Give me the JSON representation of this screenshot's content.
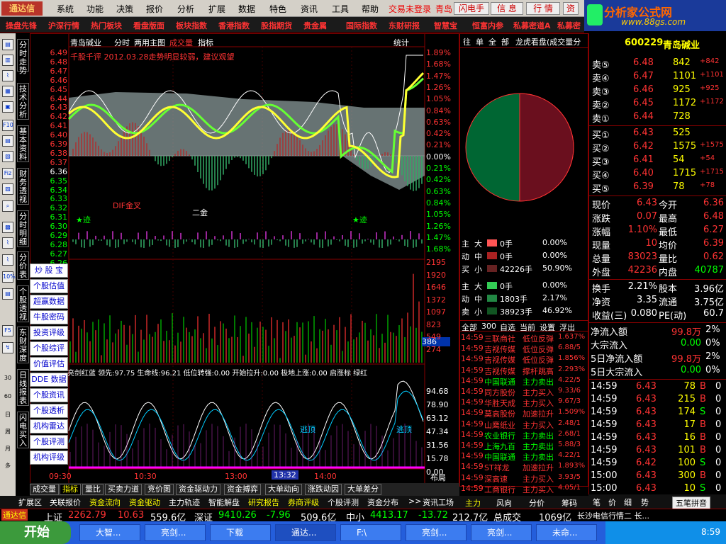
{
  "app": {
    "logo": "通达信",
    "brand_title": "分析家公式网",
    "brand_url": "www.88gs.com"
  },
  "menu": [
    "系统",
    "功能",
    "决策",
    "报价",
    "分析",
    "扩展",
    "数据",
    "特色",
    "资讯",
    "工具",
    "帮助"
  ],
  "menu_extra": {
    "trade": "交易未登录",
    "city": "青岛",
    "flash": "闪电手",
    "info": "信 息",
    "quote": "行 情",
    "more": "资"
  },
  "nav": [
    "操盘先锋",
    "沪深行情",
    "热门板块",
    "看盘版面",
    "板块指数",
    "香港指数",
    "股指期货",
    "贵金属",
    "国际指数",
    "东财研报",
    "智慧宝",
    "恒富内参",
    "私募密道A",
    "私募密"
  ],
  "left_tabs": [
    "分时走势",
    "技术分析",
    "基本资料",
    "财务透视",
    "分时明细",
    "分价表",
    "个股透视",
    "东财深度",
    "日线报表",
    "闪电买入"
  ],
  "left_tools": [
    "F10",
    "Fiz",
    "10%",
    "F5",
    "30",
    "60",
    "日",
    "周",
    "月",
    "多"
  ],
  "side_buttons": [
    "炒 股 宝",
    "个股估值",
    "超赢数据",
    "牛股密码",
    "投资评级",
    "个股综评",
    "价值评估",
    "DDE 数据",
    "个股资讯",
    "个股透析",
    "机构雷达",
    "个股评测",
    "机构评级"
  ],
  "chart": {
    "header": {
      "name": "青岛碱业",
      "mode": "分时",
      "dual": "两用主图",
      "vol": "成交量",
      "ind": "指标",
      "stats": "统计"
    },
    "note": "千股千评 2012.03.28走势明显较弱，建议观望",
    "left_axis": [
      "6.49",
      "6.48",
      "6.47",
      "6.46",
      "6.45",
      "6.44",
      "6.43",
      "6.42",
      "6.41",
      "6.40",
      "6.39",
      "6.38",
      "6.37",
      "6.36",
      "6.35",
      "6.34",
      "6.33",
      "6.32",
      "6.31",
      "6.30",
      "6.29",
      "6.28",
      "6.27",
      "6.26",
      "6.25"
    ],
    "right_axis": [
      "1.89%",
      "1.68%",
      "1.47%",
      "1.26%",
      "1.05%",
      "0.84%",
      "0.63%",
      "0.42%",
      "0.21%",
      "0.00%",
      "0.21%",
      "0.42%",
      "0.63%",
      "0.84%",
      "1.05%",
      "1.26%",
      "1.47%",
      "1.68%"
    ],
    "vol_axis": [
      "2195",
      "1920",
      "1646",
      "1372",
      "1097",
      "823",
      "549",
      "274"
    ],
    "vol_cur": "386",
    "annotations": {
      "dif": "DIF金叉",
      "er": "二金",
      "star1": "★迹",
      "star2": "★迹"
    },
    "ind_header": "亮剑红蓝 领先:97.75 生命线:96.21 低位转强:0.00 开始拉升:0.00 极地上涨:0.00 启涨标 绿红",
    "ind_axis": [
      "94.68",
      "78.90",
      "63.12",
      "47.34",
      "31.56",
      "15.78",
      "0.00"
    ],
    "ind_labels": {
      "a": "逃顶",
      "b": "逃顶"
    },
    "time_labels": [
      "09:30",
      "10:30",
      "13:00",
      "14:00"
    ],
    "time_cursor": "13:32",
    "corner": "布局"
  },
  "bottom_tabs": [
    "成交量",
    "指标",
    "量比",
    "买卖力道",
    "竞价图",
    "资金驱动力",
    "资金搏弈",
    "大单动向",
    "涨跌动因",
    "大单差分"
  ],
  "bottom_tabs2": [
    "扩展区",
    "关联报价",
    "资金流向",
    "资金驱动",
    "主力轨迹",
    "智能解盘",
    "研究报告",
    "券商评级",
    "个股评测",
    "资金分布",
    ">>",
    "资讯工场"
  ],
  "middle": {
    "tabs": [
      "往",
      "单",
      "全",
      "部",
      "龙虎看盘(成交量分"
    ],
    "pie": {
      "label": "流向饼图"
    },
    "flow": [
      {
        "side": "主",
        "size": "大",
        "vol": "0手",
        "pct": "0.00%"
      },
      {
        "side": "动",
        "size": "中",
        "vol": "0手",
        "pct": "0.00%"
      },
      {
        "side": "买",
        "size": "小",
        "vol": "42226手",
        "pct": "50.90%"
      },
      {
        "side": "主",
        "size": "大",
        "vol": "0手",
        "pct": "0.00%"
      },
      {
        "side": "动",
        "size": "中",
        "vol": "1803手",
        "pct": "2.17%"
      },
      {
        "side": "卖",
        "size": "小",
        "vol": "38923手",
        "pct": "46.92%"
      }
    ],
    "list_tabs": [
      "全部",
      "300",
      "自选",
      "当前",
      "设置",
      "浮出"
    ],
    "alerts": [
      {
        "t": "14:59",
        "n": "三联商社",
        "a": "低位反弹",
        "v": "1.637%"
      },
      {
        "t": "14:59",
        "n": "吉视传媒",
        "a": "低位反弹",
        "v": "6.88/5"
      },
      {
        "t": "14:59",
        "n": "吉视传媒",
        "a": "低位反弹",
        "v": "1.856%"
      },
      {
        "t": "14:59",
        "n": "吉视传媒",
        "a": "撑杆跳高",
        "v": "2.293%"
      },
      {
        "t": "14:59",
        "n": "中国联通",
        "a": "主力卖出",
        "v": "4.22/5"
      },
      {
        "t": "14:59",
        "n": "同方股份",
        "a": "主力买入",
        "v": "9.33/6"
      },
      {
        "t": "14:59",
        "n": "华胜天成",
        "a": "主力买入",
        "v": "9.67/3"
      },
      {
        "t": "14:59",
        "n": "莫高股份",
        "a": "加速拉升",
        "v": "1.509%"
      },
      {
        "t": "14:59",
        "n": "山鹰纸业",
        "a": "主力买入",
        "v": "2.48/1"
      },
      {
        "t": "14:59",
        "n": "农业银行",
        "a": "主力卖出",
        "v": "2.68/1"
      },
      {
        "t": "14:59",
        "n": "上海九百",
        "a": "主力卖出",
        "v": "5.88/3"
      },
      {
        "t": "14:59",
        "n": "中国联通",
        "a": "主力卖出",
        "v": "4.22/1"
      },
      {
        "t": "14:59",
        "n": "ST祥龙",
        "a": "加速拉升",
        "v": "1.893%"
      },
      {
        "t": "14:59",
        "n": "深高速",
        "a": "主力买入",
        "v": "3.93/5"
      },
      {
        "t": "14:59",
        "n": "工商银行",
        "a": "主力买入",
        "v": "4.05/1"
      }
    ]
  },
  "right": {
    "code": "600229",
    "name": "青岛碱业",
    "asks": [
      {
        "l": "卖⑤",
        "p": "6.48",
        "v": "842",
        "d": "+842"
      },
      {
        "l": "卖④",
        "p": "6.47",
        "v": "1101",
        "d": "+1101"
      },
      {
        "l": "卖③",
        "p": "6.46",
        "v": "925",
        "d": "+925"
      },
      {
        "l": "卖②",
        "p": "6.45",
        "v": "1172",
        "d": "+1172"
      },
      {
        "l": "卖①",
        "p": "6.44",
        "v": "728",
        "d": ""
      }
    ],
    "bids": [
      {
        "l": "买①",
        "p": "6.43",
        "v": "525",
        "d": ""
      },
      {
        "l": "买②",
        "p": "6.42",
        "v": "1575",
        "d": "+1575"
      },
      {
        "l": "买③",
        "p": "6.41",
        "v": "54",
        "d": "+54"
      },
      {
        "l": "买④",
        "p": "6.40",
        "v": "1715",
        "d": "+1715"
      },
      {
        "l": "买⑤",
        "p": "6.39",
        "v": "78",
        "d": "+78"
      }
    ],
    "stats": [
      [
        "现价",
        "6.43",
        "今开",
        "6.36"
      ],
      [
        "涨跌",
        "0.07",
        "最高",
        "6.48"
      ],
      [
        "涨幅",
        "1.10%",
        "最低",
        "6.27"
      ],
      [
        "现量",
        "10",
        "均价",
        "6.39"
      ],
      [
        "总量",
        "83023",
        "量比",
        "0.62"
      ],
      [
        "外盘",
        "42236",
        "内盘",
        "40787"
      ],
      [
        "换手",
        "2.21%",
        "股本",
        "3.96亿"
      ],
      [
        "净资",
        "3.35",
        "流通",
        "3.75亿"
      ],
      [
        "收益(三)",
        "0.080",
        "PE(动)",
        "60.7"
      ]
    ],
    "funds": [
      [
        "净流入额",
        "99.8万",
        "2%"
      ],
      [
        "大宗流入",
        "0.00",
        "0%"
      ],
      [
        "5日净流入额",
        "99.8万",
        "2%"
      ],
      [
        "5日大宗流入",
        "0.00",
        "0%"
      ]
    ],
    "ticks": [
      [
        "14:59",
        "6.43",
        "78",
        "B",
        "0"
      ],
      [
        "14:59",
        "6.43",
        "215",
        "B",
        "0"
      ],
      [
        "14:59",
        "6.43",
        "174",
        "S",
        "0"
      ],
      [
        "14:59",
        "6.43",
        "17",
        "B",
        "0"
      ],
      [
        "14:59",
        "6.43",
        "16",
        "B",
        "0"
      ],
      [
        "14:59",
        "6.43",
        "101",
        "B",
        "0"
      ],
      [
        "14:59",
        "6.42",
        "100",
        "S",
        "0"
      ],
      [
        "15:00",
        "6.43",
        "300",
        "B",
        "0"
      ],
      [
        "15:00",
        "6.43",
        "10",
        "S",
        "0"
      ]
    ],
    "tabs": [
      "笔",
      "价",
      "细",
      "势",
      "五笔拼音"
    ]
  },
  "main_tabs": [
    "主力",
    "风向",
    "分价",
    "筹码"
  ],
  "status": {
    "logo": "通达信",
    "sh_lbl": "上证",
    "sh": "2262.79",
    "sh_d": "10.63",
    "sh_a": "559.6亿",
    "sz_lbl": "深证",
    "sz": "9410.26",
    "sz_d": "-7.96",
    "sz_a": "509.6亿",
    "zx_lbl": "中小",
    "zx": "4413.17",
    "zx_d": "-13.72",
    "zx_a": "212.7亿",
    "total_lbl": "总成交",
    "total": "1069亿",
    "ticker": "长沙电信行情二 长..."
  },
  "taskbar": {
    "start": "开始",
    "tasks": [
      "大智...",
      "亮剑...",
      "下载",
      "通达...",
      "F:\\",
      "亮剑...",
      "亮剑...",
      "未命..."
    ],
    "time": "8:59"
  },
  "colors": {
    "up": "#ff3333",
    "down": "#00ff00",
    "bg": "#000000",
    "price": "#ffffff",
    "avg": "#ffff00"
  }
}
